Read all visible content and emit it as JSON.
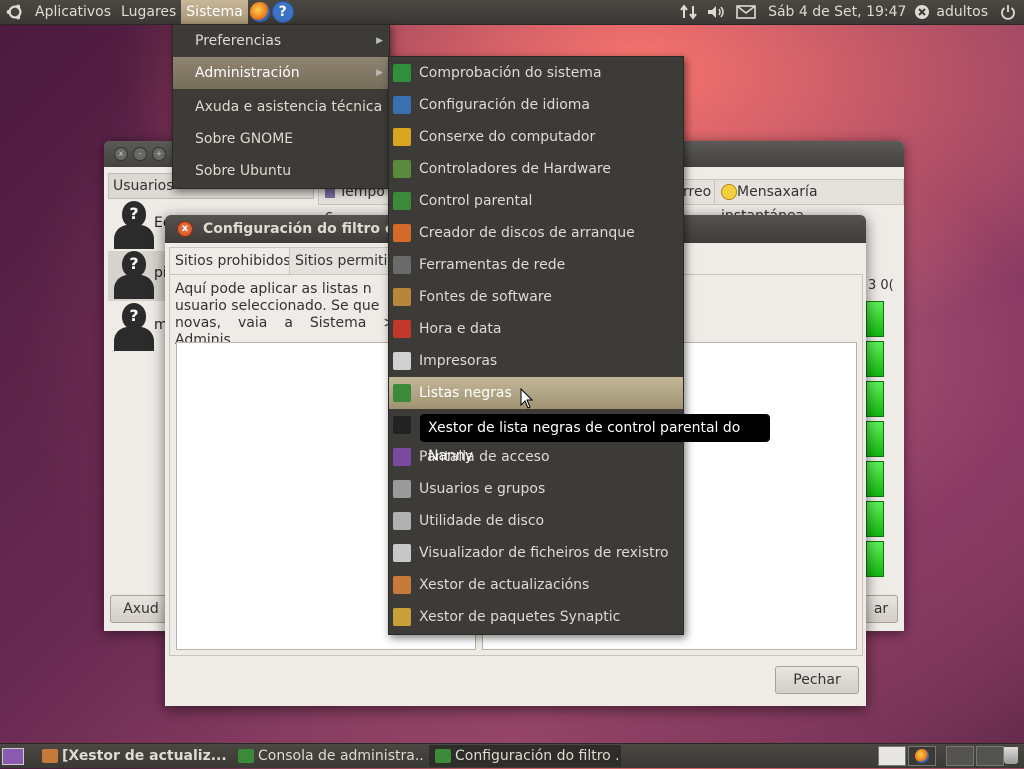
{
  "top_panel": {
    "menus": [
      "Aplicativos",
      "Lugares",
      "Sistema"
    ],
    "help_glyph": "?",
    "datetime": "Sáb  4 de Set, 19:47",
    "user": "adultos",
    "icons": [
      "ubuntu-logo-icon",
      "firefox-icon",
      "help-icon",
      "network-icon",
      "volume-icon",
      "mail-icon",
      "power-icon"
    ]
  },
  "sistema_menu": {
    "items": [
      {
        "label": "Preferencias",
        "submenu": true
      },
      {
        "label": "Administración",
        "submenu": true
      },
      {
        "label": "Axuda e asistencia técnica",
        "submenu": false
      },
      {
        "label": "Sobre GNOME",
        "submenu": false
      },
      {
        "label": "Sobre Ubuntu",
        "submenu": false
      }
    ]
  },
  "admin_menu": {
    "items": [
      {
        "label": "Comprobación do sistema",
        "icon": "check-icon",
        "color": "#2f8f3a"
      },
      {
        "label": "Configuración de idioma",
        "icon": "language-icon",
        "color": "#3a6fb0"
      },
      {
        "label": "Conserxe do computador",
        "icon": "broom-icon",
        "color": "#d9a520"
      },
      {
        "label": "Controladores de Hardware",
        "icon": "hardware-icon",
        "color": "#5a8a3a"
      },
      {
        "label": "Control parental",
        "icon": "parental-icon",
        "color": "#3a8a3a"
      },
      {
        "label": "Creador de discos de arranque",
        "icon": "disc-icon",
        "color": "#d46a2a"
      },
      {
        "label": "Ferramentas de rede",
        "icon": "network-tools-icon",
        "color": "#6a6a6a"
      },
      {
        "label": "Fontes de software",
        "icon": "software-sources-icon",
        "color": "#b8863a"
      },
      {
        "label": "Hora e data",
        "icon": "calendar-icon",
        "color": "#c0392b"
      },
      {
        "label": "Impresoras",
        "icon": "printer-icon",
        "color": "#d0d0d0"
      },
      {
        "label": "Listas negras",
        "icon": "blacklist-icon",
        "color": "#3a8a3a"
      },
      {
        "label": "",
        "icon": "monitor-icon",
        "color": "#222222"
      },
      {
        "label": "Pantalla de acceso",
        "icon": "login-screen-icon",
        "color": "#7a4aa0"
      },
      {
        "label": "Usuarios e grupos",
        "icon": "users-icon",
        "color": "#9a9a9a"
      },
      {
        "label": "Utilidade de disco",
        "icon": "disk-icon",
        "color": "#b0b0b0"
      },
      {
        "label": "Visualizador de ficheiros de rexistro",
        "icon": "log-viewer-icon",
        "color": "#c8c8c8"
      },
      {
        "label": "Xestor de actualizacións",
        "icon": "update-icon",
        "color": "#c87a3a"
      },
      {
        "label": "Xestor de paquetes Synaptic",
        "icon": "synaptic-icon",
        "color": "#c8a03a"
      }
    ],
    "highlighted": "Listas negras"
  },
  "tooltip": "Xestor de lista negras de control parental do Nanny",
  "users_window": {
    "side_header": "Usuarios",
    "users": [
      {
        "name": "Eq"
      },
      {
        "name": "pic"
      },
      {
        "name": "me"
      }
    ],
    "tabs": [
      "Tempo c",
      "rreo",
      "Mensaxaría instantánea"
    ],
    "partial_time": "3 0(",
    "help_button": "Axud",
    "close_button": "ar"
  },
  "dialog": {
    "title": "Configuración do filtro c",
    "tabs": [
      "Sitios prohibidos",
      "Sitios permitid"
    ],
    "description": "Aquí pode aplicar as listas n usuario seleccionado. Se que novas, vaia a Sistema > Adminis",
    "description_lines": [
      "Aquí pode aplicar as listas n",
      "usuario seleccionado. Se que",
      "novas, vaia a Sistema > Adminis"
    ],
    "close_button": "Pechar"
  },
  "taskbar": {
    "tasks": [
      {
        "label": "[Xestor de actualiz...",
        "selected": false,
        "bold": true
      },
      {
        "label": "Consola de administra...",
        "selected": false,
        "bold": false
      },
      {
        "label": "Configuración do filtro ...",
        "selected": true,
        "bold": false
      }
    ]
  }
}
